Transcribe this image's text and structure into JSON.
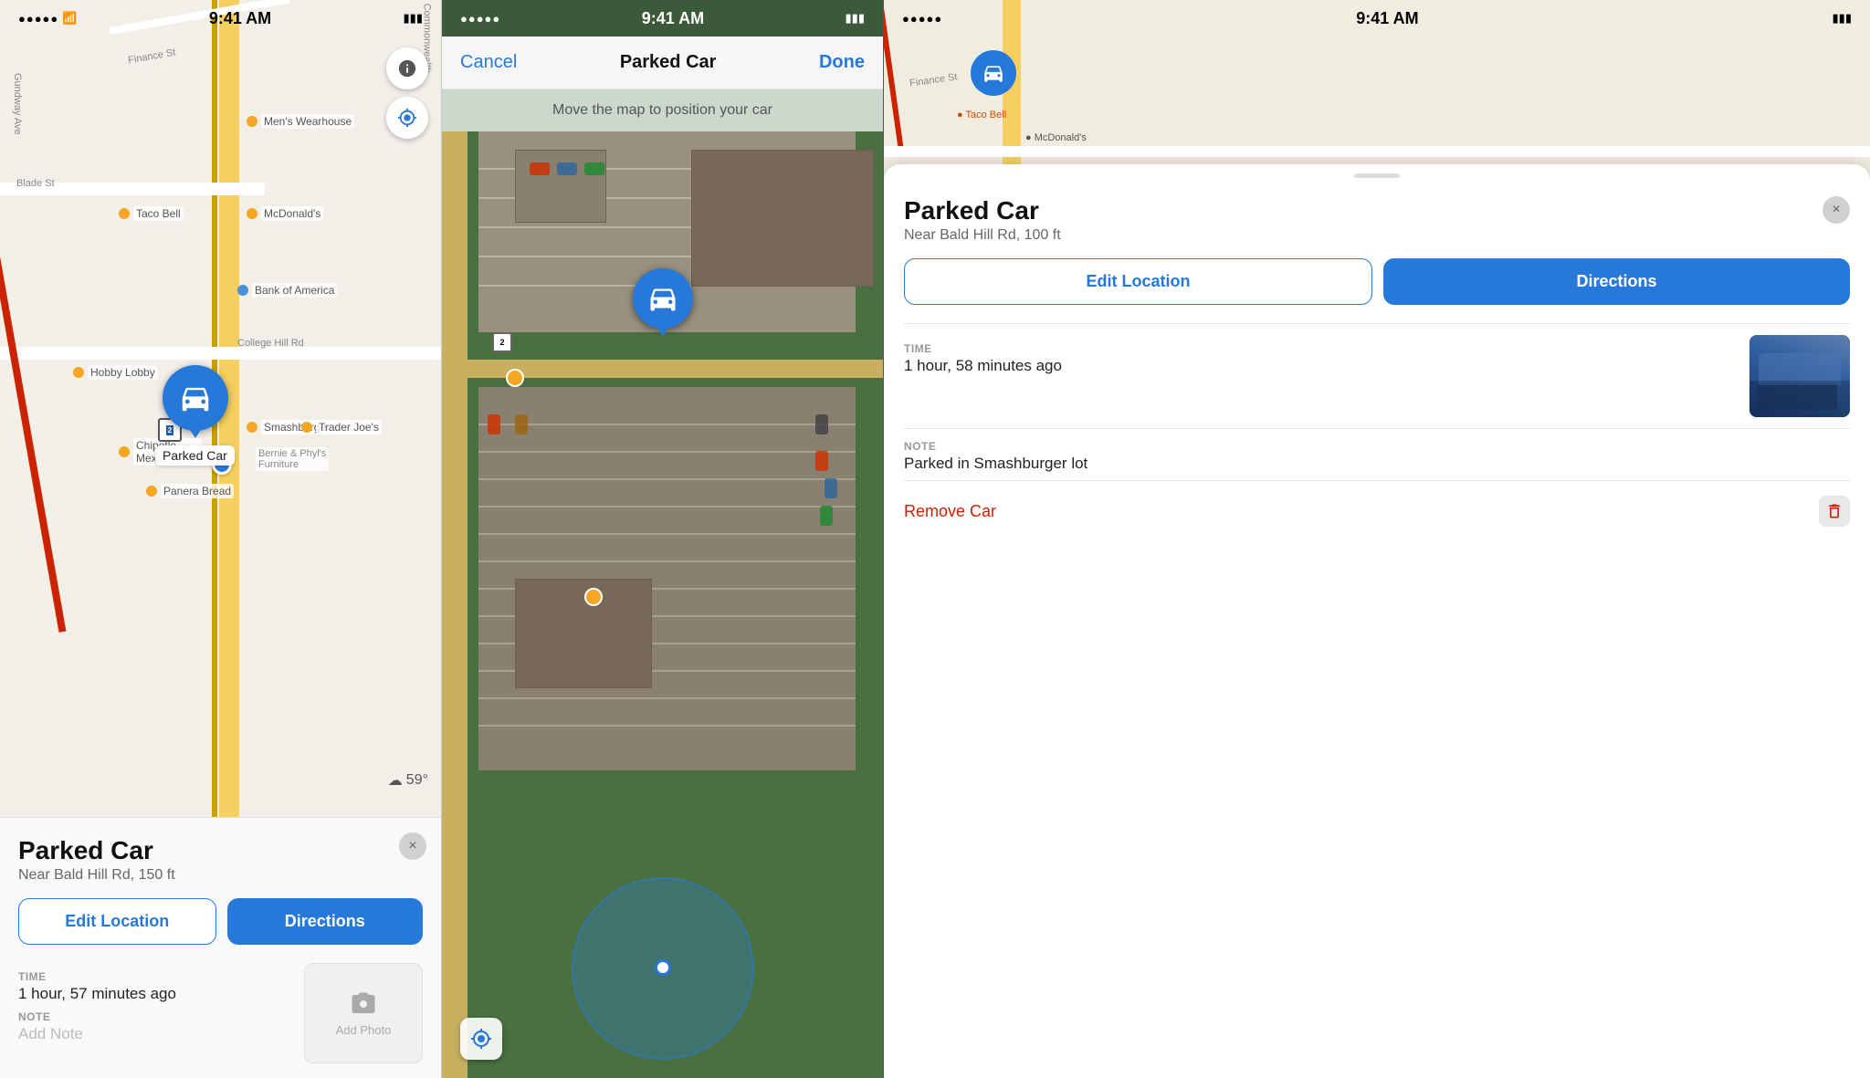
{
  "panel1": {
    "statusBar": {
      "time": "9:41 AM",
      "signal": "●●●●●",
      "wifi": "wifi",
      "battery": "battery"
    },
    "map": {
      "weather": "59°",
      "weatherIcon": "☁"
    },
    "card": {
      "title": "Parked Car",
      "subtitle": "Near Bald Hill Rd, 150 ft",
      "editLocationLabel": "Edit Location",
      "directionsLabel": "Directions",
      "closeIcon": "×",
      "timeLabel": "TIME",
      "timeValue": "1 hour, 57 minutes ago",
      "noteLabel": "NOTE",
      "notePlaceholder": "Add Note",
      "photoLabel": "Add Photo"
    }
  },
  "panel2": {
    "statusBar": {
      "time": "9:41 AM"
    },
    "topBar": {
      "cancelLabel": "Cancel",
      "title": "Parked Car",
      "doneLabel": "Done"
    },
    "hint": "Move the map to position your car"
  },
  "panel3": {
    "statusBar": {
      "time": "9:41 AM"
    },
    "card": {
      "title": "Parked Car",
      "subtitle": "Near Bald Hill Rd, 100 ft",
      "editLocationLabel": "Edit Location",
      "directionsLabel": "Directions",
      "closeIcon": "×",
      "timeLabel": "TIME",
      "timeValue": "1 hour, 58 minutes ago",
      "noteLabel": "NOTE",
      "noteValue": "Parked in Smashburger lot",
      "removeCarLabel": "Remove Car"
    }
  }
}
